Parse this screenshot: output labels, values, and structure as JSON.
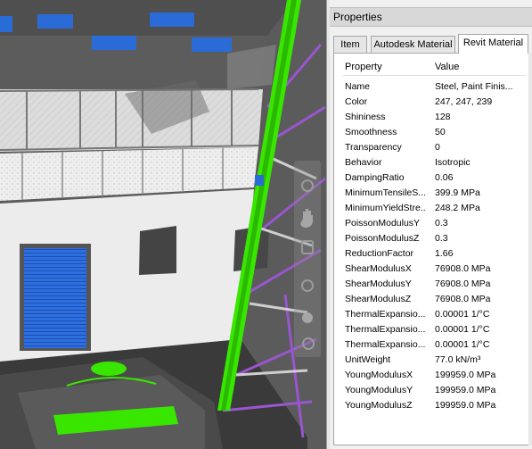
{
  "panel": {
    "title": "Properties",
    "tabs": [
      {
        "label": "Item",
        "active": false
      },
      {
        "label": "Autodesk Material",
        "active": false
      },
      {
        "label": "Revit Material",
        "active": true
      }
    ],
    "columns": {
      "property": "Property",
      "value": "Value"
    },
    "rows": [
      {
        "key": "Name",
        "value": "Steel, Paint Finis..."
      },
      {
        "key": "Color",
        "value": "247, 247, 239"
      },
      {
        "key": "Shininess",
        "value": "128"
      },
      {
        "key": "Smoothness",
        "value": "50"
      },
      {
        "key": "Transparency",
        "value": "0"
      },
      {
        "key": "Behavior",
        "value": "Isotropic"
      },
      {
        "key": "DampingRatio",
        "value": "0.06"
      },
      {
        "key": "MinimumTensileS...",
        "value": "399.9 MPa"
      },
      {
        "key": "MinimumYieldStre...",
        "value": "248.2 MPa"
      },
      {
        "key": "PoissonModulusY",
        "value": "0.3"
      },
      {
        "key": "PoissonModulusZ",
        "value": "0.3"
      },
      {
        "key": "ReductionFactor",
        "value": "1.66"
      },
      {
        "key": "ShearModulusX",
        "value": "76908.0 MPa"
      },
      {
        "key": "ShearModulusY",
        "value": "76908.0 MPa"
      },
      {
        "key": "ShearModulusZ",
        "value": "76908.0 MPa"
      },
      {
        "key": "ThermalExpansio...",
        "value": "0.00001 1/°C"
      },
      {
        "key": "ThermalExpansio...",
        "value": "0.00001 1/°C"
      },
      {
        "key": "ThermalExpansio...",
        "value": "0.00001 1/°C"
      },
      {
        "key": "UnitWeight",
        "value": "77.0 kN/m³"
      },
      {
        "key": "YoungModulusX",
        "value": "199959.0 MPa"
      },
      {
        "key": "YoungModulusY",
        "value": "199959.0 MPa"
      },
      {
        "key": "YoungModulusZ",
        "value": "199959.0 MPa"
      }
    ]
  },
  "viewport": {
    "nav_icons": [
      "orbit-icon",
      "pan-hand-icon",
      "walk-icon",
      "zoom-icon",
      "look-icon",
      "steering-wheel-icon"
    ],
    "colors": {
      "selection_green": "#39e600",
      "roof_blue": "#2a6bd8",
      "truss_purple": "#9a55d0"
    }
  }
}
